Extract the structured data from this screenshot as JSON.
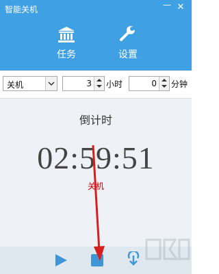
{
  "window": {
    "title": "智能关机",
    "minimize_glyph": "—",
    "close_glyph": "✕"
  },
  "nav": {
    "tabs": [
      {
        "label": "任务",
        "icon": "bank-icon"
      },
      {
        "label": "设置",
        "icon": "wrench-icon"
      }
    ]
  },
  "controls": {
    "action_select": {
      "value": "关机"
    },
    "hours": {
      "value": "3",
      "unit": "小时"
    },
    "minutes": {
      "value": "0",
      "unit": "分钟"
    }
  },
  "countdown": {
    "title": "倒计时",
    "time": "02:59:51",
    "action": "关机"
  },
  "toolbar": {
    "buttons": [
      "play-icon",
      "stop-icon",
      "download-icon"
    ]
  },
  "colors": {
    "header": "#3fa0e4",
    "main_bg": "#eef2f6",
    "bottom_bg": "#dfe7ef",
    "action_text": "#d20000",
    "annotation_arrow": "#d41f1f"
  }
}
